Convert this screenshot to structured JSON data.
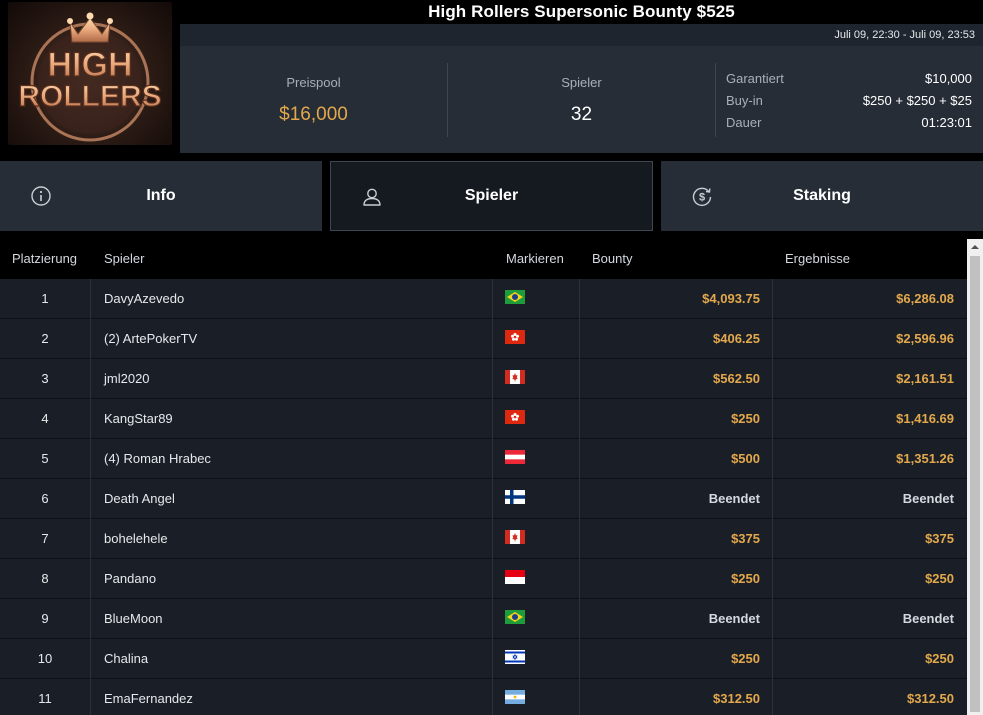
{
  "tournament": {
    "title": "High Rollers Supersonic Bounty $525",
    "date_range": "Juli 09, 22:30 - Juli 09, 23:53",
    "logo_text_line1": "HIGH",
    "logo_text_line2": "ROLLERS"
  },
  "stats": {
    "prizepool_label": "Preispool",
    "prizepool_value": "$16,000",
    "players_label": "Spieler",
    "players_value": "32"
  },
  "details": [
    {
      "key": "Garantiert",
      "value": "$10,000"
    },
    {
      "key": "Buy-in",
      "value": "$250 + $250 + $25"
    },
    {
      "key": "Dauer",
      "value": "01:23:01"
    }
  ],
  "tabs": [
    {
      "label": "Info",
      "icon": "info-icon"
    },
    {
      "label": "Spieler",
      "icon": "user-icon",
      "active": true
    },
    {
      "label": "Staking",
      "icon": "dollar-refresh-icon"
    }
  ],
  "table": {
    "headers": {
      "rank": "Platzierung",
      "player": "Spieler",
      "flag": "Markieren",
      "bounty": "Bounty",
      "results": "Ergebnisse"
    },
    "rows": [
      {
        "rank": "1",
        "name": "DavyAzevedo",
        "flag": "brazil",
        "bounty": "$4,093.75",
        "result": "$6,286.08"
      },
      {
        "rank": "2",
        "name": "(2) ArtePokerTV",
        "flag": "hong-kong",
        "bounty": "$406.25",
        "result": "$2,596.96"
      },
      {
        "rank": "3",
        "name": "jml2020",
        "flag": "canada",
        "bounty": "$562.50",
        "result": "$2,161.51"
      },
      {
        "rank": "4",
        "name": "KangStar89",
        "flag": "hong-kong",
        "bounty": "$250",
        "result": "$1,416.69"
      },
      {
        "rank": "5",
        "name": "(4) Roman Hrabec",
        "flag": "austria",
        "bounty": "$500",
        "result": "$1,351.26"
      },
      {
        "rank": "6",
        "name": "Death Angel",
        "flag": "finland",
        "bounty": "Beendet",
        "result": "Beendet"
      },
      {
        "rank": "7",
        "name": "bohelehele",
        "flag": "canada",
        "bounty": "$375",
        "result": "$375"
      },
      {
        "rank": "8",
        "name": "Pandano",
        "flag": "indonesia",
        "bounty": "$250",
        "result": "$250"
      },
      {
        "rank": "9",
        "name": "BlueMoon",
        "flag": "brazil",
        "bounty": "Beendet",
        "result": "Beendet"
      },
      {
        "rank": "10",
        "name": "Chalina",
        "flag": "israel",
        "bounty": "$250",
        "result": "$250"
      },
      {
        "rank": "11",
        "name": "EmaFernandez",
        "flag": "argentina",
        "bounty": "$312.50",
        "result": "$312.50"
      }
    ]
  },
  "colors": {
    "accent_gold": "#e3a84c",
    "panel": "#262d37",
    "row_bg": "#1a1f27",
    "active_tab": "#151a21"
  }
}
